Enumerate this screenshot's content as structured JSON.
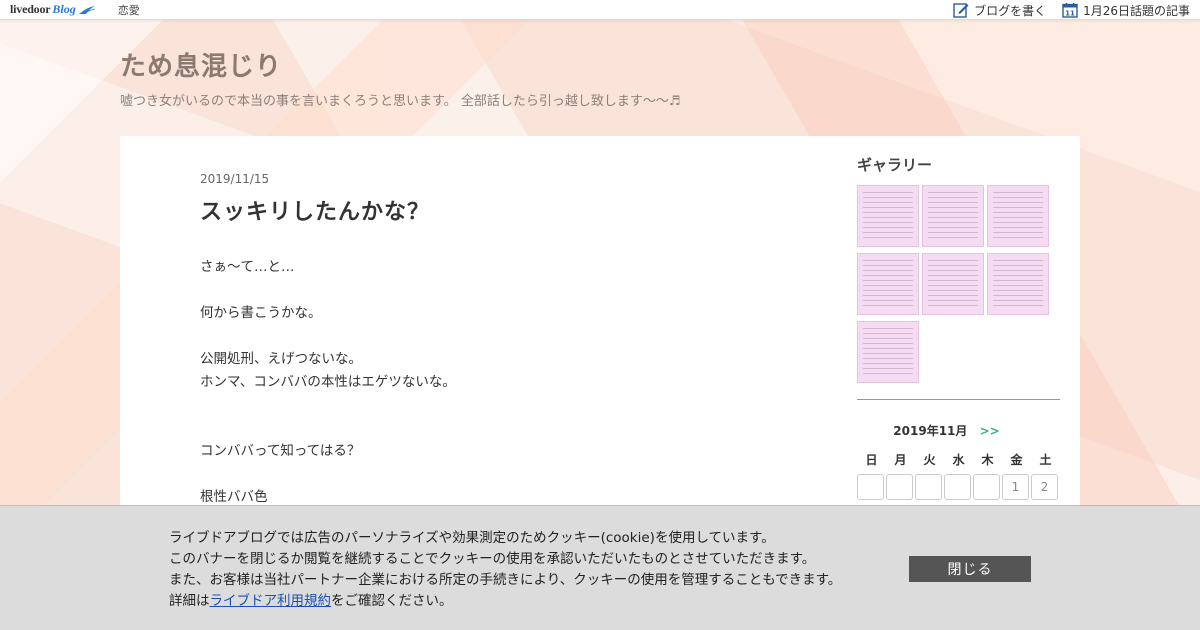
{
  "topbar": {
    "logo_text": "livedoor",
    "logo_blog": "Blog",
    "category": "恋愛",
    "write_blog": "ブログを書く",
    "trending": "1月26日話題の記事",
    "calendar_icon_day": "11"
  },
  "header": {
    "title": "ため息混じり",
    "description": "嘘つき女がいるので本当の事を言いまくろうと思います。 全部話したら引っ越し致します〜〜♬"
  },
  "article": {
    "date": "2019/11/15",
    "title": "スッキリしたんかな？",
    "lines": [
      "さぁ〜て…と…",
      "",
      "何から書こうかな。",
      "",
      "公開処刑、えげつないな。",
      "ホンマ、コンババの本性はエゲツないな。",
      "",
      "",
      "コンババって知ってはる？",
      "",
      "根性ババ色"
    ]
  },
  "sidebar": {
    "gallery_title": "ギャラリー",
    "gallery_count": 7,
    "calendar": {
      "month": "2019年11月",
      "next": ">>",
      "weekdays": [
        "日",
        "月",
        "火",
        "水",
        "木",
        "金",
        "土"
      ],
      "first_row": [
        "",
        "",
        "",
        "",
        "",
        "1",
        "2"
      ]
    }
  },
  "cookie": {
    "line1": "ライブドアブログでは広告のパーソナライズや効果測定のためクッキー(cookie)を使用しています。",
    "line2": "このバナーを閉じるか閲覧を継続することでクッキーの使用を承認いただいたものとさせていただきます。",
    "line3": "また、お客様は当社パートナー企業における所定の手続きにより、クッキーの使用を管理することもできます。",
    "line4_prefix": "詳細は",
    "line4_link": "ライブドア利用規約",
    "line4_suffix": "をご確認ください。",
    "close_label": "閉じる"
  },
  "colors": {
    "accent_link": "#1b4fb5",
    "calendar_next": "#3cae7a",
    "title_color": "#8a7a70",
    "thumb_bg": "#f6dcf2"
  }
}
